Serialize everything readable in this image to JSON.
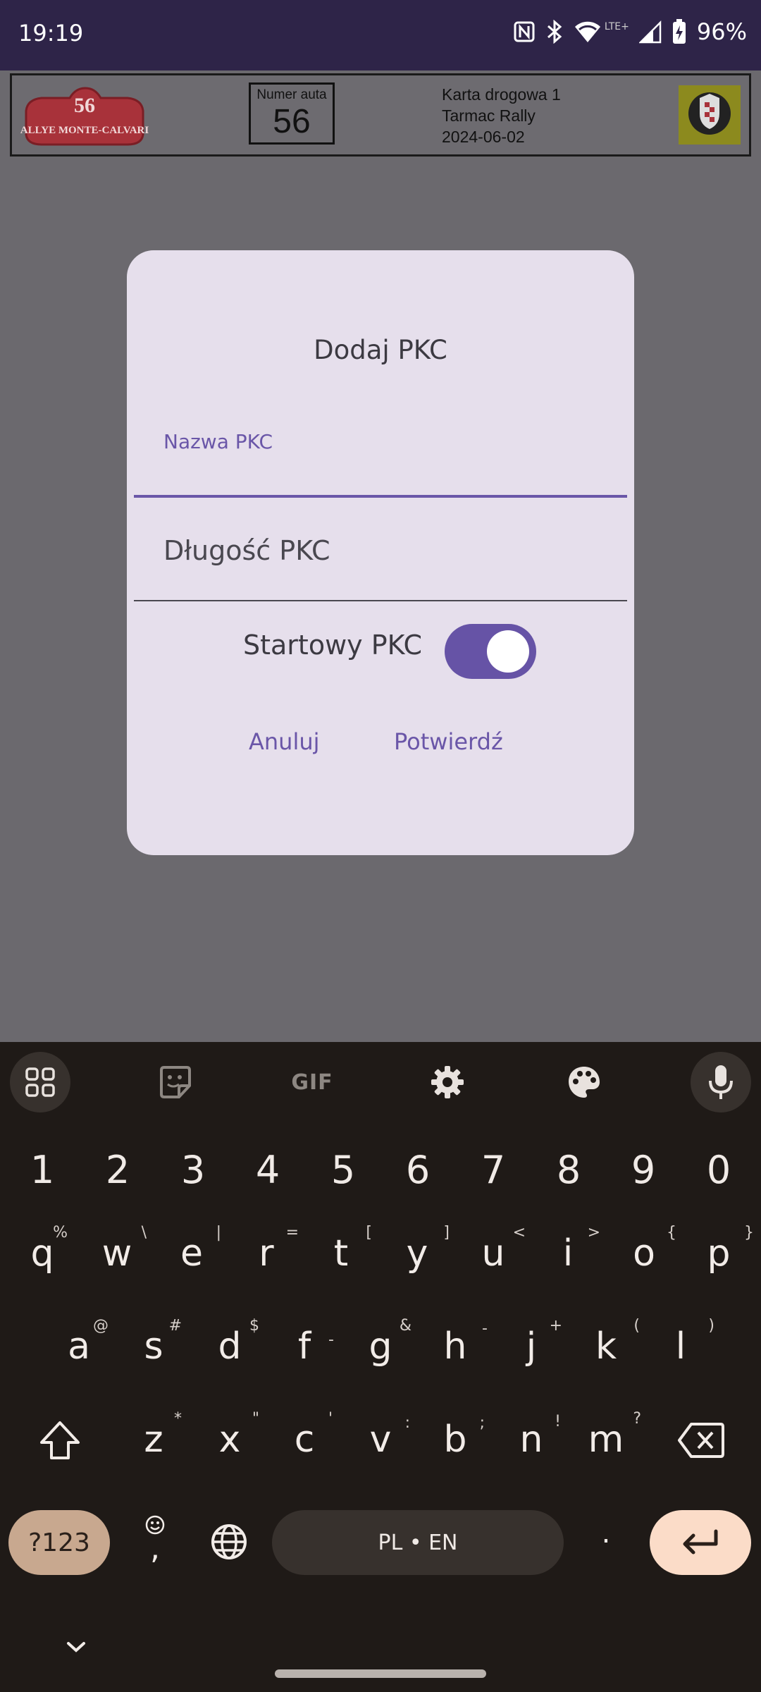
{
  "status_bar": {
    "time": "19:19",
    "battery_percent": "96%",
    "network_label": "LTE+",
    "icons": [
      "nfc-icon",
      "bluetooth-icon",
      "wifi-icon",
      "signal-icon",
      "battery-charging-icon"
    ]
  },
  "app_header": {
    "logo_number": "56",
    "logo_text": "RALLYE MONTE-CALVARIA",
    "car_number_label": "Numer auta",
    "car_number": "56",
    "card_title": "Karta drogowa 1",
    "rally_name": "Tarmac Rally",
    "date": "2024-06-02"
  },
  "dialog": {
    "title": "Dodaj PKC",
    "name_field_label": "Nazwa PKC",
    "name_field_value": "",
    "length_field_placeholder": "Długość PKC",
    "length_field_value": "",
    "start_switch_label": "Startowy PKC",
    "start_switch_on": true,
    "cancel_label": "Anuluj",
    "confirm_label": "Potwierdź",
    "accent_color": "#6653a6"
  },
  "keyboard": {
    "toolbar_gif_label": "GIF",
    "number_row": [
      "1",
      "2",
      "3",
      "4",
      "5",
      "6",
      "7",
      "8",
      "9",
      "0"
    ],
    "row1": [
      {
        "key": "q",
        "alt": "%"
      },
      {
        "key": "w",
        "alt": "\\"
      },
      {
        "key": "e",
        "alt": "|"
      },
      {
        "key": "r",
        "alt": "="
      },
      {
        "key": "t",
        "alt": "["
      },
      {
        "key": "y",
        "alt": "]"
      },
      {
        "key": "u",
        "alt": "<"
      },
      {
        "key": "i",
        "alt": ">"
      },
      {
        "key": "o",
        "alt": "{"
      },
      {
        "key": "p",
        "alt": "}"
      }
    ],
    "row2": [
      {
        "key": "a",
        "alt": "@"
      },
      {
        "key": "s",
        "alt": "#"
      },
      {
        "key": "d",
        "alt": "$"
      },
      {
        "key": "f",
        "alt": "-"
      },
      {
        "key": "g",
        "alt": "&"
      },
      {
        "key": "h",
        "alt": "-"
      },
      {
        "key": "j",
        "alt": "+"
      },
      {
        "key": "k",
        "alt": "("
      },
      {
        "key": "l",
        "alt": ")"
      }
    ],
    "row3": [
      {
        "key": "z",
        "alt": "*"
      },
      {
        "key": "x",
        "alt": "\""
      },
      {
        "key": "c",
        "alt": "'"
      },
      {
        "key": "v",
        "alt": ":"
      },
      {
        "key": "b",
        "alt": ";"
      },
      {
        "key": "n",
        "alt": "!"
      },
      {
        "key": "m",
        "alt": "?"
      }
    ],
    "symbols_label": "?123",
    "comma_label": ",",
    "space_label": "PL • EN",
    "period_label": "."
  }
}
